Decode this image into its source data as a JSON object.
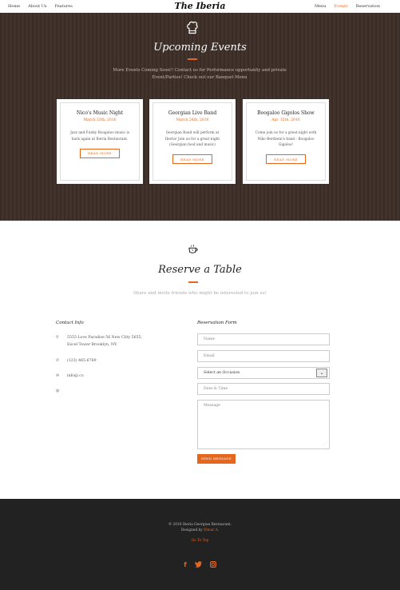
{
  "nav": {
    "brand": "The Iberia",
    "left": [
      "Home",
      "About Us",
      "Features"
    ],
    "right": [
      "Menu",
      "Events",
      "Reservation"
    ],
    "active": "Events"
  },
  "events": {
    "title": "Upcoming Events",
    "subtitle": "More Events Coming Soon!! Contact us for Performance opportunity and private Event/Parties! Check out our Banquet Menu",
    "cards": [
      {
        "title": "Nico's Music Night",
        "date": "March 13th, 2016",
        "desc": "Jazz and Funky Boogaloo music is back again at Iberia Restaurant.",
        "button": "READ MORE"
      },
      {
        "title": "Georgian Live Band",
        "date": "March 28th, 2016",
        "desc": "Georgian Band will perform at Iberia! Join us for a great night (Georgian food and music)",
        "button": "READ MORE"
      },
      {
        "title": "Boogaloo Gigolos Show",
        "date": "Apr. 15th, 2016",
        "desc": "Come join us for a great night with Niko Berdzeni's band - Boogaloo Gigolos!",
        "button": "READ MORE"
      }
    ]
  },
  "reserve": {
    "title": "Reserve a Table",
    "subtitle": "Share and invite friends who might be interested to join us!",
    "contact_heading": "Contact Info",
    "address_line1": "5555 Love Paradise 56 New Clity 5655,",
    "address_line2": "Excel Tower Brooklyn, NY.",
    "phone": "(123) 465-6789",
    "email": "info@.co",
    "form_heading": "Reservation Form",
    "name_placeholder": "Name",
    "email_placeholder": "Email",
    "occasion_value": "Select an Occasion",
    "datetime_placeholder": "Date & Time",
    "message_placeholder": "Message",
    "send_label": "SEND MESSAGE"
  },
  "footer": {
    "copyright": "© 2016 Iberia Georgian Restaurant.",
    "designed_prefix": "Designed by",
    "designer": "Elmar A.",
    "go_top": "Go To Top",
    "social": [
      "facebook-icon",
      "twitter-icon",
      "instagram-icon"
    ]
  },
  "colors": {
    "accent": "#e6661d",
    "footer_bg": "#222222",
    "events_bg": "#3e3029"
  }
}
